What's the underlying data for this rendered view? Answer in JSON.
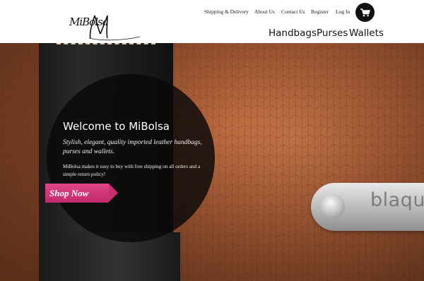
{
  "brand": {
    "logo_text": "MiBolsa"
  },
  "utility_nav": [
    {
      "label": "Shipping & Delivery"
    },
    {
      "label": "About Us"
    },
    {
      "label": "Contact Us"
    },
    {
      "label": "Register"
    },
    {
      "label": "Log In"
    }
  ],
  "cart": {
    "icon": "cart-icon"
  },
  "main_nav": [
    {
      "label": "Handbags"
    },
    {
      "label": "Purses"
    },
    {
      "label": "Wallets"
    }
  ],
  "hero": {
    "title": "Welcome to MiBolsa",
    "tagline": "Stylish, elegant, quality imported leather handbags, purses and wallets.",
    "description": "MiBolsa makes it easy to buy with free shipping on all orders and a simple return policy!",
    "cta_label": "Shop Now",
    "plate_text": "blaqu"
  },
  "colors": {
    "accent": "#d23a7b",
    "leather": "#b5643a",
    "overlay": "#080808"
  }
}
